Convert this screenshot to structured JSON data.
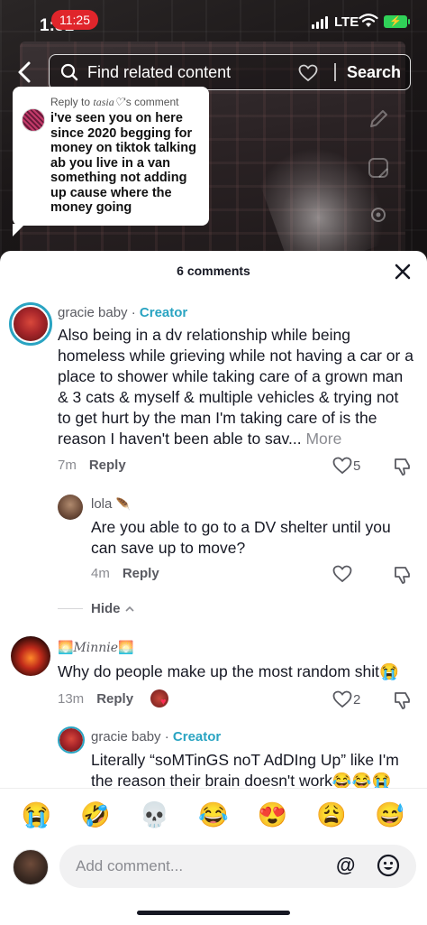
{
  "status": {
    "time": "1:51",
    "pill_time": "11:25",
    "network": "LTE",
    "battery_icon": "charging-battery-icon"
  },
  "search": {
    "placeholder": "Find related content",
    "button": "Search"
  },
  "reply_bubble": {
    "prefix": "Reply to",
    "target_user": "tasia♡",
    "suffix": "'s comment",
    "text": "i've seen you on here since 2020 begging for money on tiktok talking ab you live in a van something not adding up cause where the money going"
  },
  "sheet": {
    "title": "6 comments"
  },
  "comments": [
    {
      "user": "gracie baby",
      "separator": " · ",
      "tag": "Creator",
      "text": "Also being in a dv relationship while being homeless while grieving while not having a car or a place to shower while taking care of a grown man & 3 cats & myself & multiple vehicles & trying not to get hurt by the man I'm taking care of is the reason I haven't been able to sav...",
      "more": "More",
      "time": "7m",
      "reply_label": "Reply",
      "likes": "5"
    },
    {
      "user": "lola",
      "text": "Are you able to go to a DV shelter until you can save up to move?",
      "time": "4m",
      "reply_label": "Reply"
    },
    {
      "user": "🌅𝑀𝑖𝑛𝑛𝑖𝑒🌅",
      "text": "Why do people make up the most random shit😭",
      "time": "13m",
      "reply_label": "Reply",
      "likes": "2"
    },
    {
      "user": "gracie baby",
      "separator": " · ",
      "tag": "Creator",
      "text": "Literally “soMTinGS noT AdDIng Up” like I'm the reason their brain doesn't work😂😂😭"
    }
  ],
  "hide_label": "Hide",
  "emoji_bar": [
    "😭",
    "🤣",
    "💀",
    "😂",
    "😍",
    "😩",
    "😅"
  ],
  "composer": {
    "placeholder": "Add comment...",
    "mention": "@"
  }
}
